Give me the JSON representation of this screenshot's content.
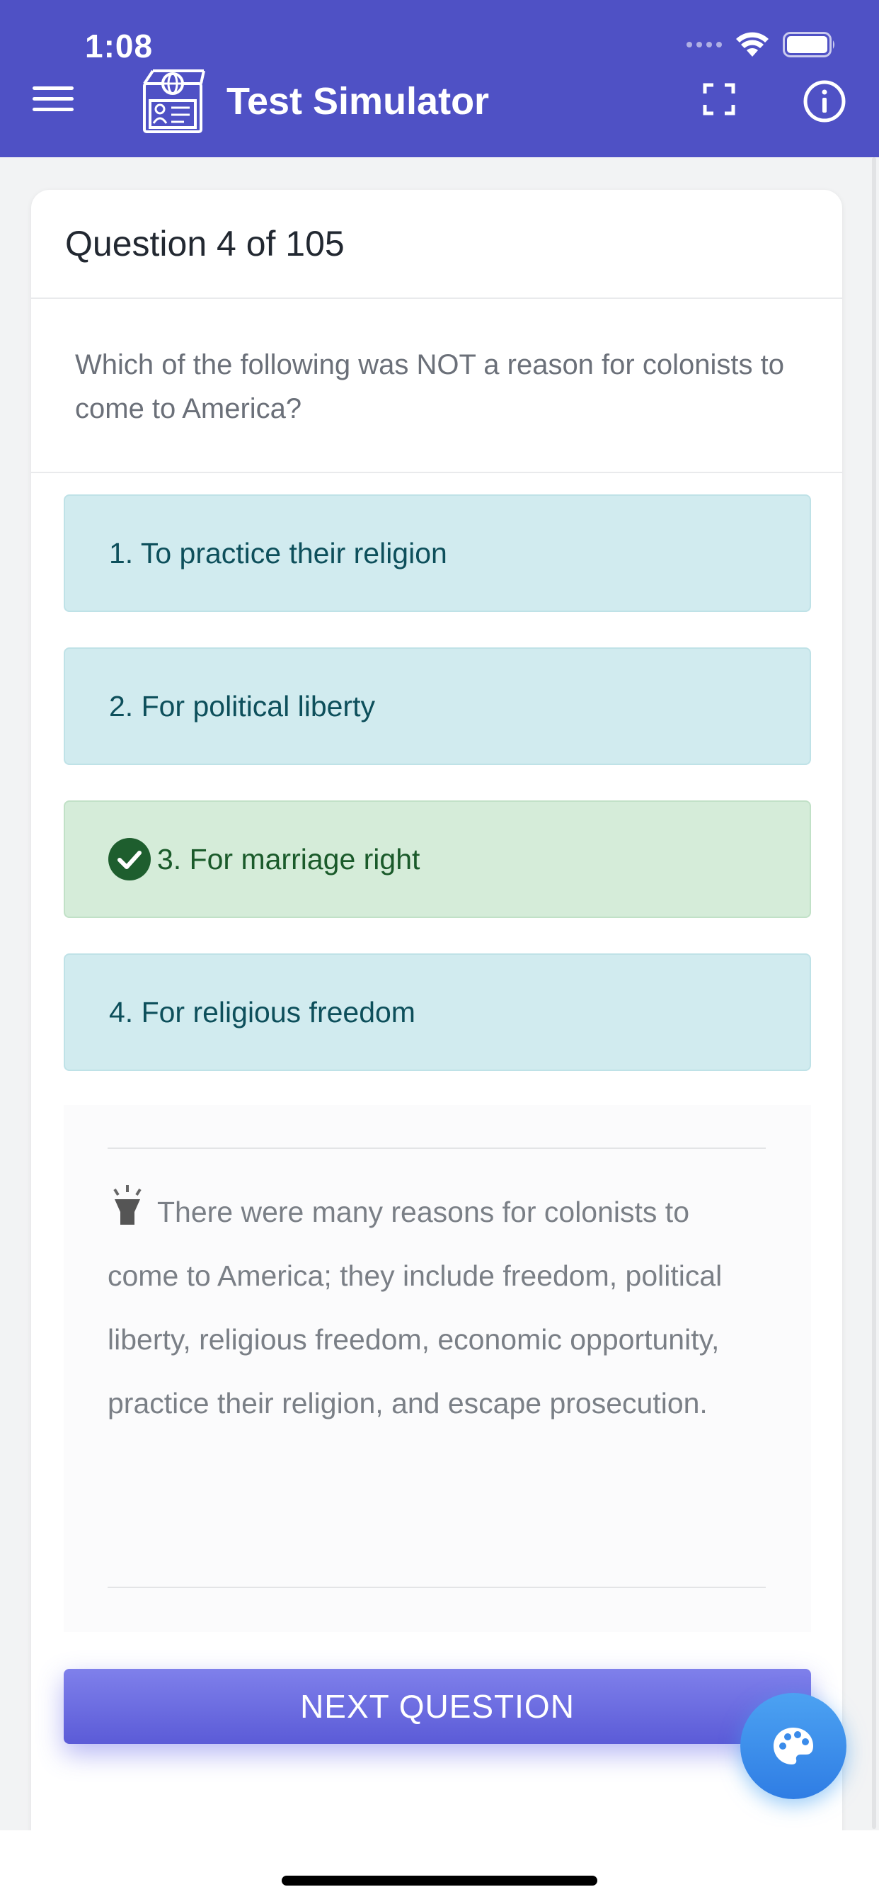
{
  "status_bar": {
    "time": "1:08"
  },
  "header": {
    "title": "Test Simulator",
    "menu_icon": "hamburger-menu-icon",
    "logo_icon": "passport-id-icon",
    "fullscreen_icon": "fullscreen-icon",
    "info_icon": "info-icon"
  },
  "question": {
    "progress_label": "Question 4 of 105",
    "text": "Which of the following was NOT a reason for colonists to come to America?"
  },
  "answers": [
    {
      "label": "1. To practice their religion",
      "state": "neutral"
    },
    {
      "label": "2. For political liberty",
      "state": "neutral"
    },
    {
      "label": "3. For marriage right",
      "state": "correct"
    },
    {
      "label": "4. For religious freedom",
      "state": "neutral"
    }
  ],
  "explanation": {
    "icon": "lightbulb-icon",
    "text": "There were many reasons for colonists to come to America; they include freedom, political liberty, religious freedom, economic opportunity, practice their religion, and escape prosecution."
  },
  "actions": {
    "next_label": "NEXT QUESTION",
    "fab_icon": "palette-icon"
  },
  "colors": {
    "primary": "#4f51c5",
    "answer_bg": "#d1ebef",
    "correct_bg": "#d5ecd9",
    "correct_check": "#1e5e2e",
    "fab": "#2f7de4"
  }
}
